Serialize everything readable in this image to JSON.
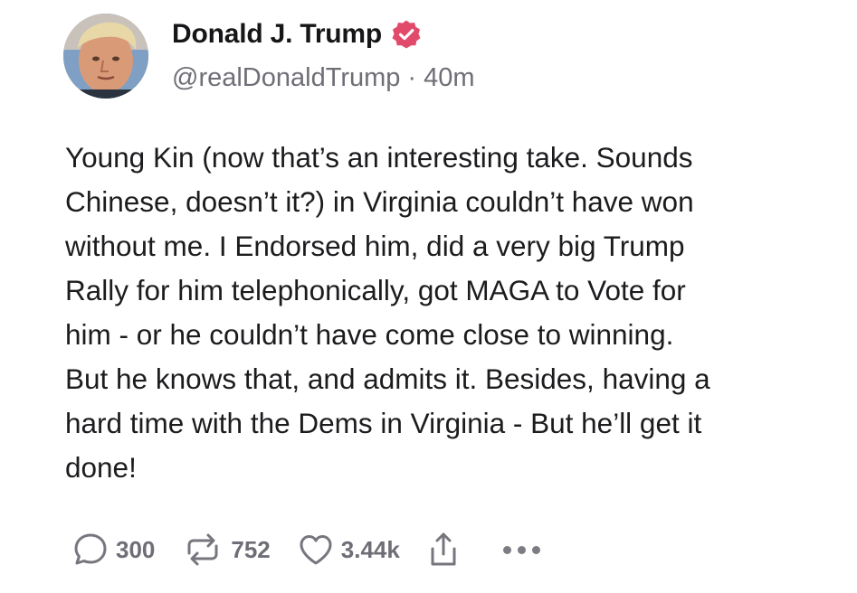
{
  "post": {
    "author": {
      "display_name": "Donald J. Trump",
      "handle": "@realDonaldTrump",
      "verified": true,
      "verified_color": "#e24a6b"
    },
    "separator": "·",
    "time_ago": "40m",
    "body": "Young Kin (now that’s an interesting take. Sounds\nChinese, doesn’t it?) in Virginia couldn’t have won\nwithout me. I Endorsed him, did a very big Trump\nRally for him telephonically, got MAGA to Vote for\nhim - or he couldn’t have come close to winning.\nBut he knows that, and admits it. Besides, having a\nhard time with the Dems in Virginia - But he’ll get it\ndone!",
    "actions": {
      "replies": "300",
      "reposts": "752",
      "likes": "3.44k"
    },
    "icons": {
      "reply": "comment-bubble-icon",
      "repost": "repost-arrows-icon",
      "like": "heart-icon",
      "share": "share-upload-icon",
      "more": "more-dots-icon",
      "verified": "verified-badge-icon"
    }
  }
}
